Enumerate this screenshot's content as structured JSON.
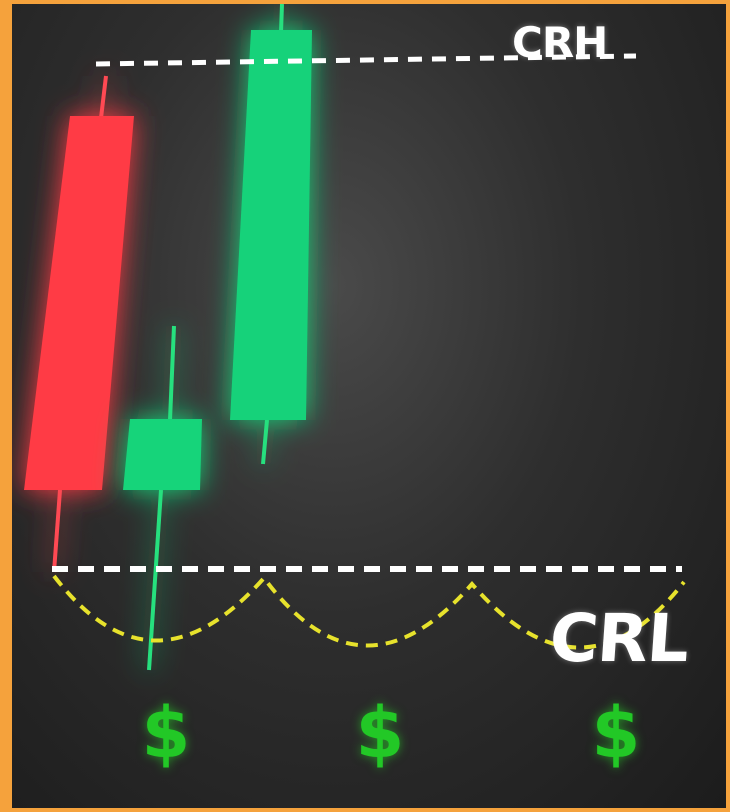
{
  "levels": {
    "high_label": "CRH",
    "low_label": "CRL"
  },
  "candles": [
    {
      "direction": "bearish",
      "color": "#ff3b44"
    },
    {
      "direction": "bullish",
      "color": "#17d27a"
    },
    {
      "direction": "bullish",
      "color": "#17d27a"
    }
  ],
  "profit_markers": [
    "$",
    "$",
    "$"
  ],
  "colors": {
    "frame_border": "#f5a23c",
    "background": "#2a2a2a",
    "bearish": "#ff3b44",
    "bullish": "#17d27a",
    "level_line": "#ffffff",
    "swing_curve": "#e7e22c",
    "dollar": "#22c826"
  }
}
